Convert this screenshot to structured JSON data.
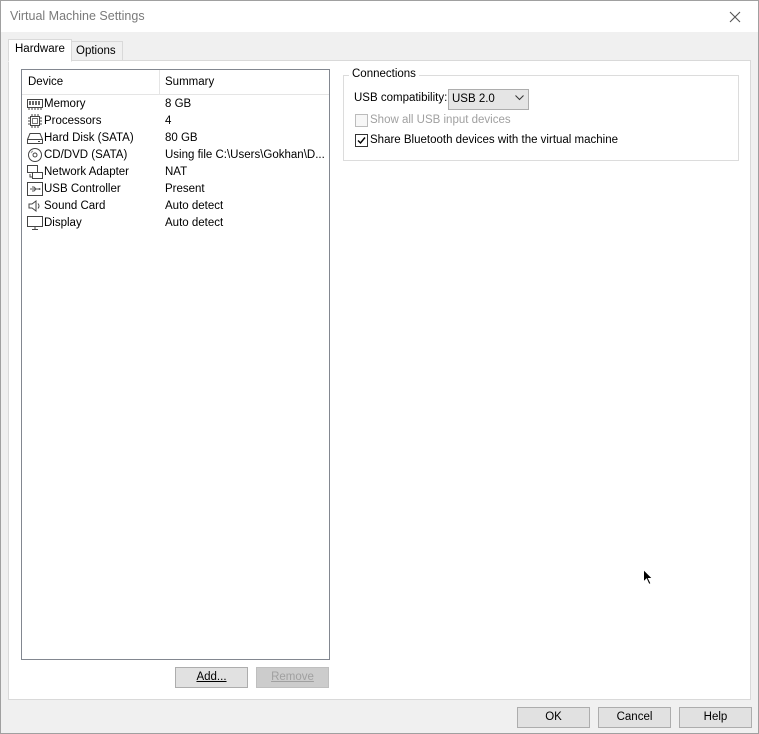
{
  "window": {
    "title": "Virtual Machine Settings"
  },
  "tabs": [
    {
      "label": "Hardware",
      "active": true
    },
    {
      "label": "Options",
      "active": false
    }
  ],
  "device_list": {
    "columns": [
      "Device",
      "Summary"
    ],
    "rows": [
      {
        "icon": "memory-icon",
        "device": "Memory",
        "summary": "8 GB"
      },
      {
        "icon": "processor-icon",
        "device": "Processors",
        "summary": "4"
      },
      {
        "icon": "hard-disk-icon",
        "device": "Hard Disk (SATA)",
        "summary": "80 GB"
      },
      {
        "icon": "cd-dvd-icon",
        "device": "CD/DVD (SATA)",
        "summary": "Using file C:\\Users\\Gokhan\\D..."
      },
      {
        "icon": "network-adapter-icon",
        "device": "Network Adapter",
        "summary": "NAT"
      },
      {
        "icon": "usb-icon",
        "device": "USB Controller",
        "summary": "Present"
      },
      {
        "icon": "sound-card-icon",
        "device": "Sound Card",
        "summary": "Auto detect"
      },
      {
        "icon": "display-icon",
        "device": "Display",
        "summary": "Auto detect"
      }
    ]
  },
  "list_buttons": {
    "add": "Add...",
    "remove": "Remove"
  },
  "connections": {
    "legend": "Connections",
    "usb_compat_label": "USB compatibility:",
    "usb_compat_value": "USB 2.0",
    "show_all_usb_label": "Show all USB input devices",
    "show_all_usb_checked": false,
    "share_bluetooth_label": "Share Bluetooth devices with the virtual machine",
    "share_bluetooth_checked": true
  },
  "footer": {
    "ok": "OK",
    "cancel": "Cancel",
    "help": "Help"
  }
}
